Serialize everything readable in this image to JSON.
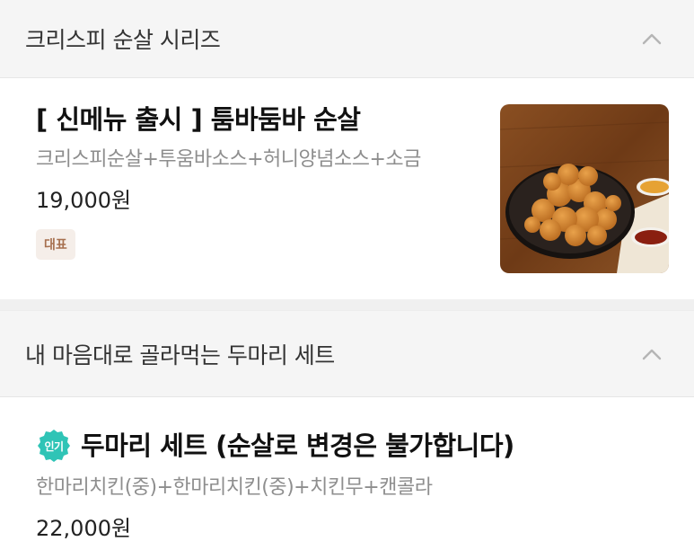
{
  "sections": [
    {
      "title": "크리스피 순살 시리즈",
      "items": [
        {
          "name": "[ 신메뉴 출시 ] 툼바둠바 순살",
          "description": "크리스피순살+투움바소스+허니양념소스+소금",
          "price": "19,000원",
          "badge": "대표"
        }
      ]
    },
    {
      "title": "내 마음대로 골라먹는 두마리 세트",
      "items": [
        {
          "popular_badge": "인기",
          "name": "두마리 세트 (순살로 변경은 불가합니다)",
          "description": "한마리치킨(중)+한마리치킨(중)+치킨무+캔콜라",
          "price": "22,000원"
        }
      ]
    }
  ],
  "colors": {
    "header_bg": "#f5f5f5",
    "badge_bg": "#f5eee9",
    "badge_text": "#a7704f",
    "popular_badge": "#2fc4b6"
  },
  "icons": [
    "chevron-up-icon",
    "popular-badge-icon"
  ]
}
